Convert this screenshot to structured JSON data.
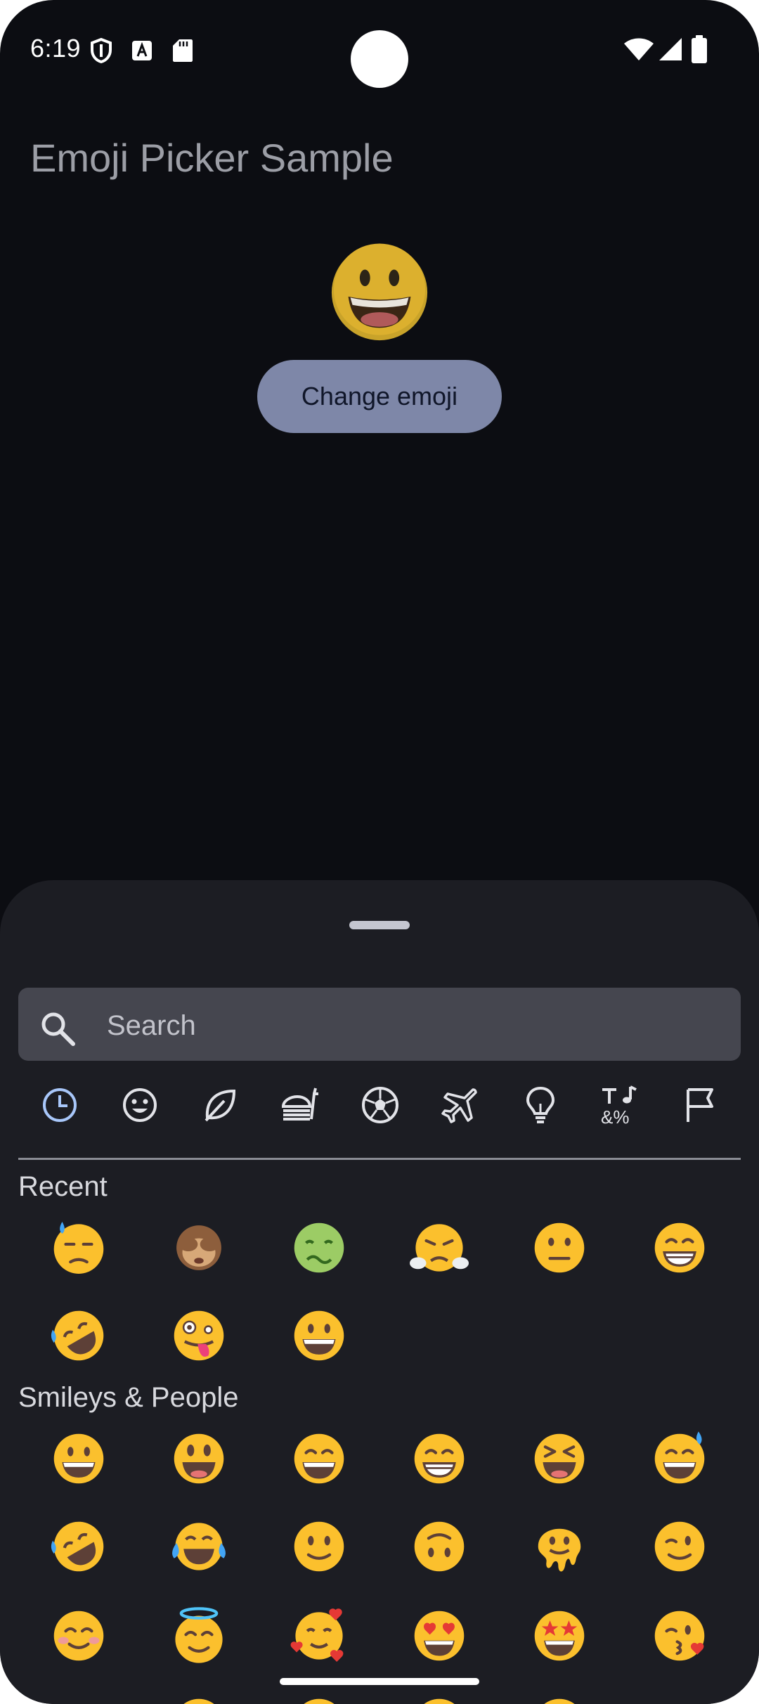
{
  "status_bar": {
    "time": "6:19",
    "icons": [
      "shield-icon",
      "font-a-icon",
      "sd-card-icon",
      "wifi-icon",
      "signal-icon",
      "battery-icon"
    ]
  },
  "app": {
    "title": "Emoji Picker Sample",
    "selected_emoji": "grinning-face",
    "change_button_label": "Change emoji",
    "button_color": "#7e87a8"
  },
  "picker": {
    "search_placeholder": "Search",
    "categories": [
      {
        "name": "recent",
        "icon": "clock-icon",
        "selected": true
      },
      {
        "name": "smileys",
        "icon": "smiley-icon"
      },
      {
        "name": "nature",
        "icon": "leaf-icon"
      },
      {
        "name": "food",
        "icon": "food-icon"
      },
      {
        "name": "activities",
        "icon": "soccer-ball-icon"
      },
      {
        "name": "travel",
        "icon": "airplane-icon"
      },
      {
        "name": "objects",
        "icon": "lightbulb-icon"
      },
      {
        "name": "symbols",
        "icon": "symbols-icon"
      },
      {
        "name": "flags",
        "icon": "flag-icon"
      }
    ],
    "sections": [
      {
        "title": "Recent",
        "emojis": [
          "downcast-sweat",
          "speak-no-evil-monkey",
          "nauseated-face",
          "steam-nose-face",
          "neutral-face",
          "beaming-face",
          "rofl-face",
          "zany-face",
          "grinning-face"
        ]
      },
      {
        "title": "Smileys & People",
        "emojis": [
          "grinning-face",
          "grinning-big-eyes",
          "grinning-smiling-eyes",
          "beaming-face",
          "squinting-laugh",
          "grinning-sweat",
          "rofl-face",
          "tears-of-joy",
          "slight-smile",
          "upside-down-face",
          "melting-face",
          "winking-face",
          "smiling-blush",
          "halo-face",
          "hearts-face",
          "heart-eyes",
          "star-struck",
          "kissing-face"
        ]
      }
    ],
    "accent_color": "#a8c7fa",
    "emoji_color": "#fbc02d"
  }
}
